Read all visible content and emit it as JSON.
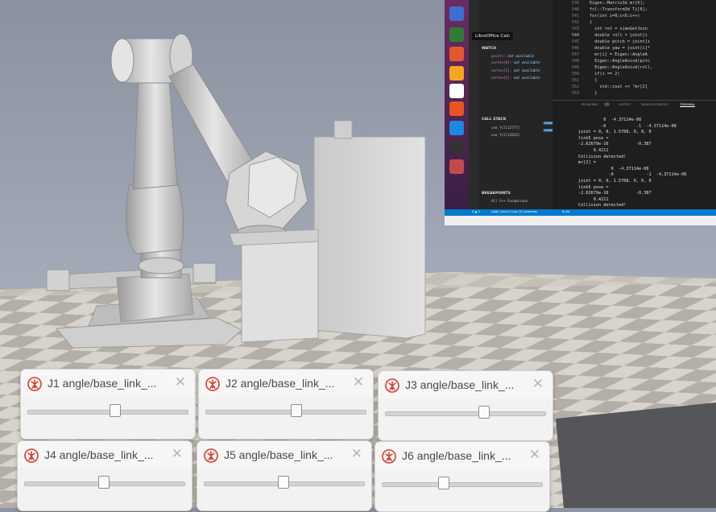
{
  "viewport": {
    "colors": {
      "sky_top": "#8a91a0",
      "sky_bottom": "#b9bec9",
      "floor_light": "#d8d4cd",
      "floor_dark": "#b3aea6",
      "robot": "#d9d9d9",
      "machine": "#dcdcdc"
    }
  },
  "ide": {
    "tooltip": "LibreOffice Calc",
    "sections": {
      "watch": "WATCH",
      "call_stack": "CALL STACK",
      "breakpoints": "BREAKPOINTS"
    },
    "watch_items": [
      {
        "name": "points:",
        "value": "not available"
      },
      {
        "name": "vertex[0]:",
        "value": "not available"
      },
      {
        "name": "vertex[1]:",
        "value": "not available"
      },
      {
        "name": "vertex[2]:",
        "value": "not available"
      }
    ],
    "call_stack": [
      {
        "name": "use_fcl[22777]",
        "status": "RUNNING"
      },
      {
        "name": "use_fcl[22813]",
        "status": "RUNNING"
      }
    ],
    "breakpoint_item": "All C++ Exceptions",
    "line_numbers": [
      "539",
      "540",
      "541",
      "542",
      "543",
      "544",
      "545",
      "546",
      "547",
      "548",
      "549",
      "550",
      "551",
      "552",
      "553"
    ],
    "code_lines": [
      "Eigen::Matrix3d mr[6];",
      "fcl::Transform3d Tj[6];",
      "for(int i=0;i<6;i++)",
      "{",
      "  int ret = simxGetJoin",
      "  double roll = joint[i",
      "  double pitch = joint[i",
      "  double yaw = joint[i]*",
      "  mr[i] = Eigen::AngleA",
      "  Eigen::AngleAxisd(pitc",
      "  Eigen::AngleAxisd(roll,",
      "  if(i == 2)",
      "  {",
      "    std::cout << \"mr[2]",
      "  }"
    ],
    "panel_tabs": [
      "PROBLEMS",
      "OUTPUT",
      "DEBUG CONSOLE",
      "TERMINAL"
    ],
    "problems_count": "13",
    "terminal_lines": [
      "          0  -4.37114e-08",
      "         -0            -1  -4.37114e-08",
      "joint = 0, 0, 1.5708, 0, 0, 0",
      "link5 pose =",
      "-2.62679e-16           -0.387",
      "      0.4211",
      "Collision detected!",
      "mr[2] =",
      "             0  -4.37114e-08",
      "            -0             -1  -4.37114e-08",
      "joint = 0, 0, 1.5708, 0, 0, 0",
      "link5 pose =",
      "-2.62679e-16           -0.387",
      "      0.4211",
      "Collision detected!"
    ],
    "status_left": "0 ▲ 0",
    "status_mid": "(gdb) Launch (use_fcl_example)",
    "status_right": "Build"
  },
  "sliders": [
    {
      "title": "J1 angle/base_link_...",
      "value": 0.55
    },
    {
      "title": "J2 angle/base_link_...",
      "value": 0.57
    },
    {
      "title": "J3 angle/base_link_...",
      "value": 0.62
    },
    {
      "title": "J4 angle/base_link_...",
      "value": 0.5
    },
    {
      "title": "J5 angle/base_link_...",
      "value": 0.5
    },
    {
      "title": "J6 angle/base_link_...",
      "value": 0.39
    }
  ],
  "close_glyph": "✕"
}
